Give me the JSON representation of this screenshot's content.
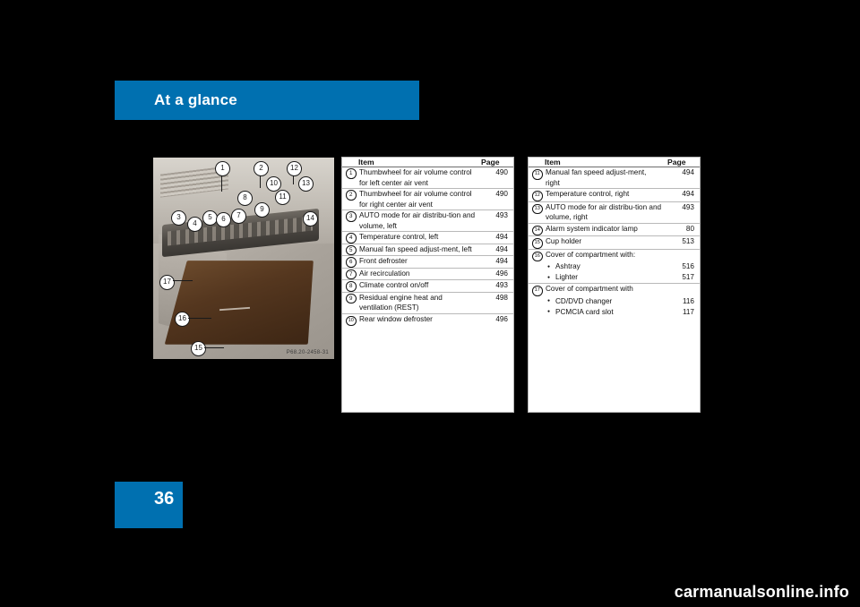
{
  "header": {
    "title": "At a glance"
  },
  "page_number": "36",
  "illustration": {
    "credit": "P68.20-2458-31",
    "callouts": [
      "1",
      "2",
      "12",
      "8",
      "10",
      "11",
      "13",
      "3",
      "4",
      "5",
      "6",
      "7",
      "9",
      "14",
      "17",
      "16",
      "15"
    ]
  },
  "tables": [
    {
      "headers": {
        "item": "Item",
        "page": "Page"
      },
      "rows": [
        {
          "num": "1",
          "text": "Thumbwheel for air volume control for left center air vent",
          "page": "490"
        },
        {
          "num": "2",
          "text": "Thumbwheel for air volume control for right center air vent",
          "page": "490"
        },
        {
          "num": "3",
          "text": "AUTO mode for air distribu-tion and volume, left",
          "page": "493"
        },
        {
          "num": "4",
          "text": "Temperature control, left",
          "page": "494"
        },
        {
          "num": "5",
          "text": "Manual fan speed adjust-ment, left",
          "page": "494"
        },
        {
          "num": "6",
          "text": "Front defroster",
          "page": "494"
        },
        {
          "num": "7",
          "text": "Air recirculation",
          "page": "496"
        },
        {
          "num": "8",
          "text": "Climate control on/off",
          "page": "493"
        },
        {
          "num": "9",
          "text": "Residual engine heat and ventilation (REST)",
          "page": "498"
        },
        {
          "num": "10",
          "text": "Rear window defroster",
          "page": "496"
        }
      ]
    },
    {
      "headers": {
        "item": "Item",
        "page": "Page"
      },
      "rows": [
        {
          "num": "11",
          "text": "Manual fan speed adjust-ment, right",
          "page": "494"
        },
        {
          "num": "12",
          "text": "Temperature control, right",
          "page": "494"
        },
        {
          "num": "13",
          "text": "AUTO mode for air distribu-tion and volume, right",
          "page": "493"
        },
        {
          "num": "14",
          "text": "Alarm system indicator lamp",
          "page": "80"
        },
        {
          "num": "15",
          "text": "Cup holder",
          "page": "513"
        },
        {
          "num": "16",
          "text": "Cover of compartment with:",
          "page": "",
          "subs": [
            {
              "text": "Ashtray",
              "page": "516"
            },
            {
              "text": "Lighter",
              "page": "517"
            }
          ]
        },
        {
          "num": "17",
          "text": "Cover of compartment with",
          "page": "",
          "subs": [
            {
              "text": "CD/DVD changer",
              "page": "116"
            },
            {
              "text": "PCMCIA card slot",
              "page": "117"
            }
          ]
        }
      ]
    }
  ],
  "watermark": "carmanualsonline.info",
  "colors": {
    "accent": "#0070b0",
    "background": "#000000",
    "paper": "#ffffff"
  }
}
